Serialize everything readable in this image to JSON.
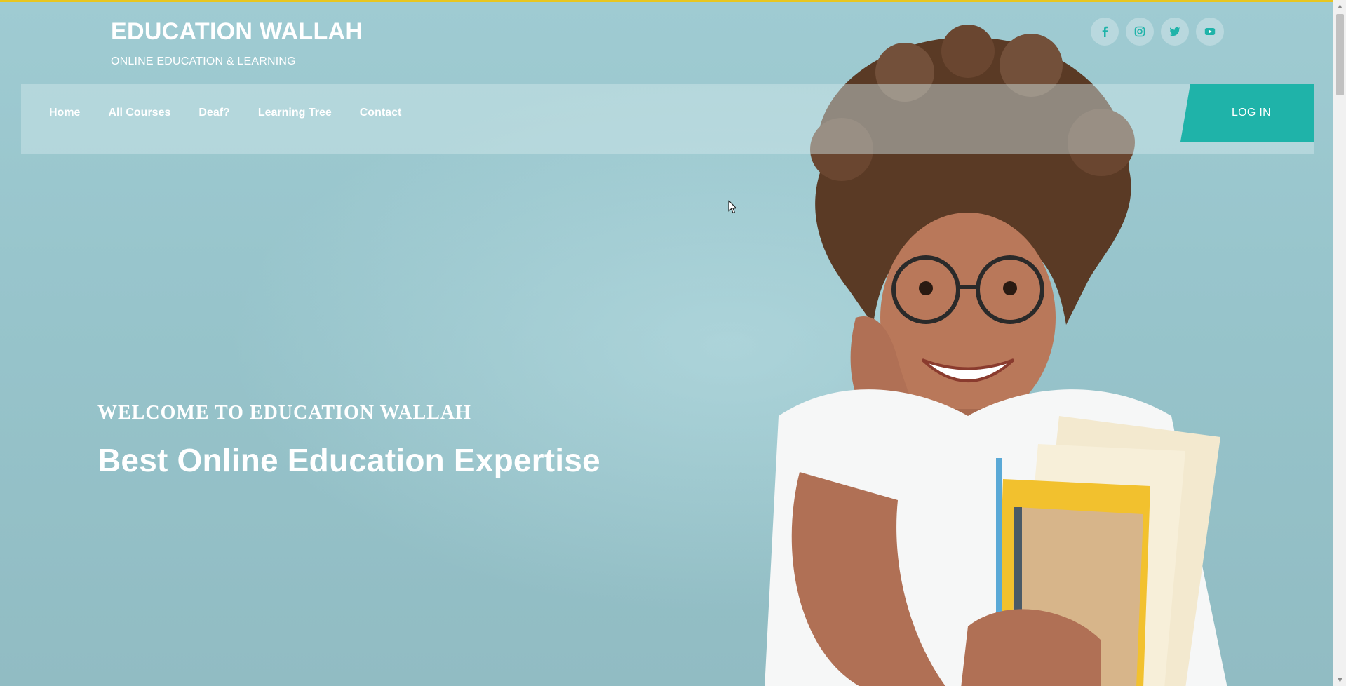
{
  "brand": {
    "title": "EDUCATION WALLAH",
    "tagline": "ONLINE EDUCATION & LEARNING"
  },
  "social": [
    {
      "name": "facebook-icon"
    },
    {
      "name": "instagram-icon"
    },
    {
      "name": "twitter-icon"
    },
    {
      "name": "youtube-icon"
    }
  ],
  "nav": {
    "items": [
      "Home",
      "All Courses",
      "Deaf?",
      "Learning Tree",
      "Contact"
    ],
    "login_label": "LOG IN"
  },
  "hero": {
    "eyebrow": "WELCOME TO EDUCATION WALLAH",
    "headline": "Best Online Education Expertise"
  },
  "colors": {
    "accent": "#1fb3a9",
    "background": "#9fcbd2",
    "top_border": "#e8c61f"
  }
}
